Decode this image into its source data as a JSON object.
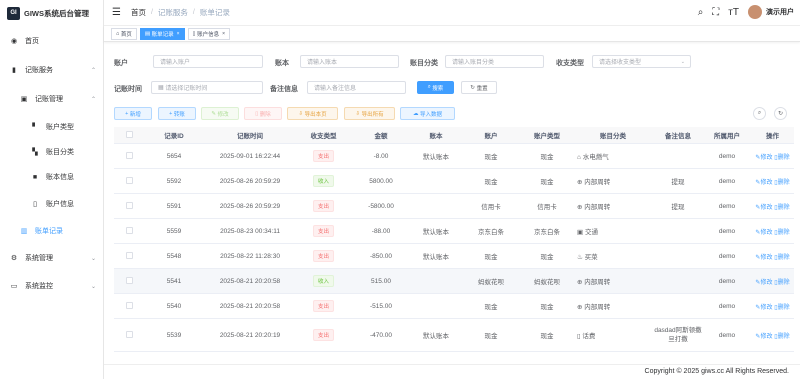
{
  "app": {
    "title": "GIWS系统后台管理",
    "logo_text": "GI"
  },
  "sidebar": {
    "items": [
      {
        "label": "首页",
        "icon": "dashboard-icon"
      },
      {
        "label": "记账服务",
        "icon": "wallet-icon"
      },
      {
        "label": "记账管理",
        "icon": "folder-icon"
      },
      {
        "label": "账户类型",
        "icon": "doc-icon"
      },
      {
        "label": "账目分类",
        "icon": "doc-icon"
      },
      {
        "label": "账本信息",
        "icon": "book-icon"
      },
      {
        "label": "账户信息",
        "icon": "card-icon"
      },
      {
        "label": "账单记录",
        "icon": "chart-icon"
      },
      {
        "label": "系统管理",
        "icon": "gear-icon"
      },
      {
        "label": "系统监控",
        "icon": "monitor-icon"
      }
    ]
  },
  "breadcrumb": [
    "首页",
    "记账服务",
    "账单记录"
  ],
  "header": {
    "username": "演示用户"
  },
  "tags": [
    {
      "label": "首页"
    },
    {
      "label": "账单记录"
    },
    {
      "label": "账户信息"
    }
  ],
  "search": {
    "account_label": "账户",
    "account_placeholder": "请输入账户",
    "ledger_label": "账本",
    "ledger_placeholder": "请输入账本",
    "category_label": "账目分类",
    "category_placeholder": "请输入账目分类",
    "type_label": "收支类型",
    "type_placeholder": "请选择收支类型",
    "time_label": "记账时间",
    "time_placeholder": "请选择记账时间",
    "remark_label": "备注信息",
    "remark_placeholder": "请输入备注信息",
    "search_btn": "搜索",
    "reset_btn": "重置"
  },
  "toolbar": {
    "add": "新增",
    "transfer": "转账",
    "edit": "修改",
    "delete": "删除",
    "export_page": "导出本页",
    "export_all": "导出所有",
    "import": "导入数据"
  },
  "table": {
    "headers": [
      "",
      "记录ID",
      "记账时间",
      "收支类型",
      "金额",
      "账本",
      "账户",
      "账户类型",
      "账目分类",
      "备注信息",
      "所属用户",
      "操作"
    ],
    "edit_label": "修改",
    "delete_label": "删除",
    "rows": [
      {
        "id": "5654",
        "time": "2025-09-01 16:22:44",
        "type": "支出",
        "amount": "-8.00",
        "ledger": "默认账本",
        "account": "现金",
        "acc_type": "现金",
        "category": "水电燃气",
        "cat_icon": "house-icon",
        "cat_glyph": "⌂",
        "remark": "",
        "user": "demo"
      },
      {
        "id": "5592",
        "time": "2025-08-26 20:59:29",
        "type": "收入",
        "amount": "5800.00",
        "ledger": "",
        "account": "现金",
        "acc_type": "现金",
        "category": "内部周转",
        "cat_icon": "exchange-icon",
        "cat_glyph": "⊕",
        "remark": "提现",
        "user": "demo"
      },
      {
        "id": "5591",
        "time": "2025-08-26 20:59:29",
        "type": "支出",
        "amount": "-5800.00",
        "ledger": "",
        "account": "信用卡",
        "acc_type": "信用卡",
        "category": "内部周转",
        "cat_icon": "exchange-icon",
        "cat_glyph": "⊕",
        "remark": "提现",
        "user": "demo"
      },
      {
        "id": "5559",
        "time": "2025-08-23 00:34:11",
        "type": "支出",
        "amount": "-88.00",
        "ledger": "默认账本",
        "account": "京东白条",
        "acc_type": "京东白条",
        "category": "交通",
        "cat_icon": "bus-icon",
        "cat_glyph": "▣",
        "remark": "",
        "user": "demo"
      },
      {
        "id": "5548",
        "time": "2025-08-22 11:28:30",
        "type": "支出",
        "amount": "-850.00",
        "ledger": "默认账本",
        "account": "现金",
        "acc_type": "现金",
        "category": "买菜",
        "cat_icon": "basket-icon",
        "cat_glyph": "♨",
        "remark": "",
        "user": "demo"
      },
      {
        "id": "5541",
        "time": "2025-08-21 20:20:58",
        "type": "收入",
        "amount": "515.00",
        "ledger": "",
        "account": "蚂蚁花呗",
        "acc_type": "蚂蚁花呗",
        "category": "内部周转",
        "cat_icon": "exchange-icon",
        "cat_glyph": "⊕",
        "remark": "",
        "user": "demo"
      },
      {
        "id": "5540",
        "time": "2025-08-21 20:20:58",
        "type": "支出",
        "amount": "-515.00",
        "ledger": "",
        "account": "现金",
        "acc_type": "现金",
        "category": "内部周转",
        "cat_icon": "exchange-icon",
        "cat_glyph": "⊕",
        "remark": "",
        "user": "demo"
      },
      {
        "id": "5539",
        "time": "2025-08-21 20:20:19",
        "type": "支出",
        "amount": "-470.00",
        "ledger": "默认账本",
        "account": "现金",
        "acc_type": "现金",
        "category": "话费",
        "cat_icon": "phone-icon",
        "cat_glyph": "▯",
        "remark": "dasdad阿斯顿撒旦打撒",
        "user": "demo"
      }
    ]
  },
  "footer": {
    "copyright": "Copyright © 2025 giws.cc All Rights Reserved."
  },
  "colors": {
    "primary": "#409eff",
    "income": "#67c23a",
    "expense": "#f56c6c"
  }
}
